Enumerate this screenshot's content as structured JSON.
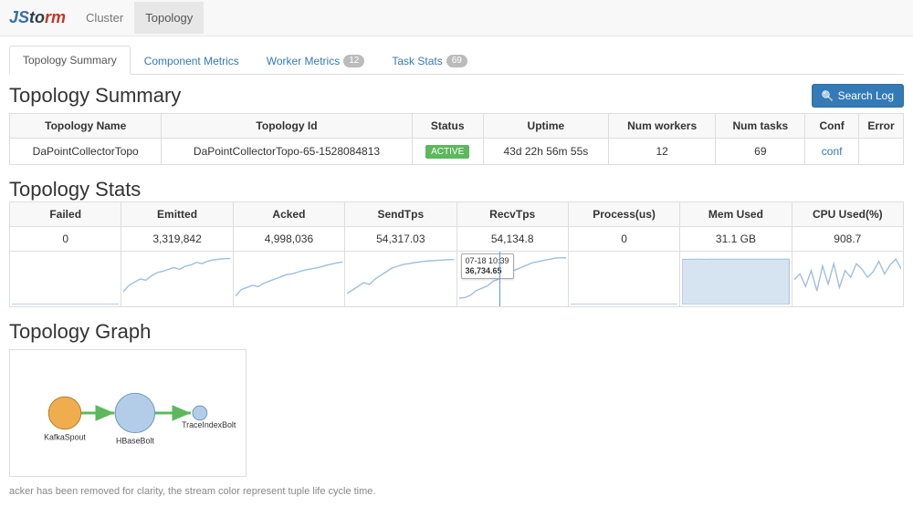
{
  "nav": {
    "logo_text": "JStorm",
    "cluster": "Cluster",
    "topology": "Topology"
  },
  "tabs": {
    "summary": "Topology Summary",
    "component": "Component Metrics",
    "worker": "Worker Metrics",
    "worker_count": "12",
    "task": "Task Stats",
    "task_count": "69"
  },
  "buttons": {
    "search_log": "Search Log"
  },
  "sections": {
    "summary": "Topology Summary",
    "stats": "Topology Stats",
    "graph": "Topology Graph"
  },
  "summary_table": {
    "headers": {
      "name": "Topology Name",
      "id": "Topology Id",
      "status": "Status",
      "uptime": "Uptime",
      "workers": "Num workers",
      "tasks": "Num tasks",
      "conf": "Conf",
      "error": "Error"
    },
    "row": {
      "name": "DaPointCollectorTopo",
      "id": "DaPointCollectorTopo-65-1528084813",
      "status": "ACTIVE",
      "uptime": "43d 22h 56m 55s",
      "workers": "12",
      "tasks": "69",
      "conf": "conf",
      "error": ""
    }
  },
  "stats_table": {
    "headers": {
      "failed": "Failed",
      "emitted": "Emitted",
      "acked": "Acked",
      "sendtps": "SendTps",
      "recvtps": "RecvTps",
      "process": "Process(us)",
      "mem": "Mem Used",
      "cpu": "CPU Used(%)"
    },
    "row": {
      "failed": "0",
      "emitted": "3,319,842",
      "acked": "4,998,036",
      "sendtps": "54,317.03",
      "recvtps": "54,134.8",
      "process": "0",
      "mem": "31.1 GB",
      "cpu": "908.7"
    },
    "tooltip": {
      "time": "07-18 10:39",
      "value": "36,734.65"
    }
  },
  "chart_data": [
    {
      "name": "Failed",
      "type": "line",
      "values": [
        0,
        0,
        0,
        0,
        0,
        0,
        0,
        0,
        0,
        0,
        0,
        0,
        0,
        0,
        0,
        0,
        0,
        0,
        0,
        0
      ],
      "ylim": [
        0,
        1
      ]
    },
    {
      "name": "Emitted",
      "type": "line",
      "values": [
        2800000,
        2900000,
        2950000,
        3000000,
        2980000,
        3050000,
        3100000,
        3120000,
        3150000,
        3180000,
        3150000,
        3200000,
        3220000,
        3260000,
        3240000,
        3280000,
        3300000,
        3310000,
        3320000,
        3319842
      ],
      "ylim": [
        2600000,
        3400000
      ]
    },
    {
      "name": "Acked",
      "type": "line",
      "values": [
        4200000,
        4350000,
        4400000,
        4450000,
        4420000,
        4500000,
        4550000,
        4600000,
        4650000,
        4700000,
        4720000,
        4760000,
        4800000,
        4830000,
        4850000,
        4880000,
        4920000,
        4950000,
        4980000,
        4998036
      ],
      "ylim": [
        4000000,
        5200000
      ]
    },
    {
      "name": "SendTps",
      "type": "line",
      "values": [
        45000,
        46000,
        47000,
        48000,
        47500,
        49000,
        50000,
        51000,
        52000,
        52500,
        53000,
        53200,
        53500,
        53700,
        53900,
        54000,
        54100,
        54200,
        54300,
        54317
      ],
      "ylim": [
        42000,
        56000
      ]
    },
    {
      "name": "RecvTps",
      "type": "line",
      "values": [
        36734,
        37000,
        38000,
        40000,
        41000,
        42000,
        44000,
        45000,
        47000,
        48000,
        49000,
        50000,
        51000,
        52000,
        52500,
        53000,
        53500,
        54000,
        54100,
        54135
      ],
      "ylim": [
        34000,
        56000
      ],
      "cursor_index": 0
    },
    {
      "name": "Process(us)",
      "type": "line",
      "values": [
        0,
        0,
        0,
        0,
        0,
        0,
        0,
        0,
        0,
        0,
        0,
        0,
        0,
        0,
        0,
        0,
        0,
        0,
        0,
        0
      ],
      "ylim": [
        0,
        1
      ]
    },
    {
      "name": "Mem Used",
      "type": "area",
      "values": [
        31.0,
        31.0,
        31.1,
        31.1,
        31.0,
        31.1,
        31.1,
        31.1,
        31.1,
        31.1,
        31.1,
        31.1,
        31.1,
        31.1,
        31.1,
        31.1,
        31.1,
        31.1,
        31.1,
        31.1
      ],
      "ylim": [
        0,
        35
      ]
    },
    {
      "name": "CPU Used(%)",
      "type": "line",
      "values": [
        820,
        870,
        760,
        900,
        720,
        940,
        780,
        960,
        750,
        900,
        840,
        960,
        910,
        840,
        890,
        980,
        870,
        950,
        1000,
        909
      ],
      "ylim": [
        600,
        1050
      ]
    }
  ],
  "graph": {
    "nodes": {
      "spout": "KafkaSpout",
      "bolt1": "HBaseBolt",
      "bolt2": "TraceIndexBolt"
    }
  },
  "footer": "acker has been removed for clarity, the stream color represent tuple life cycle time."
}
